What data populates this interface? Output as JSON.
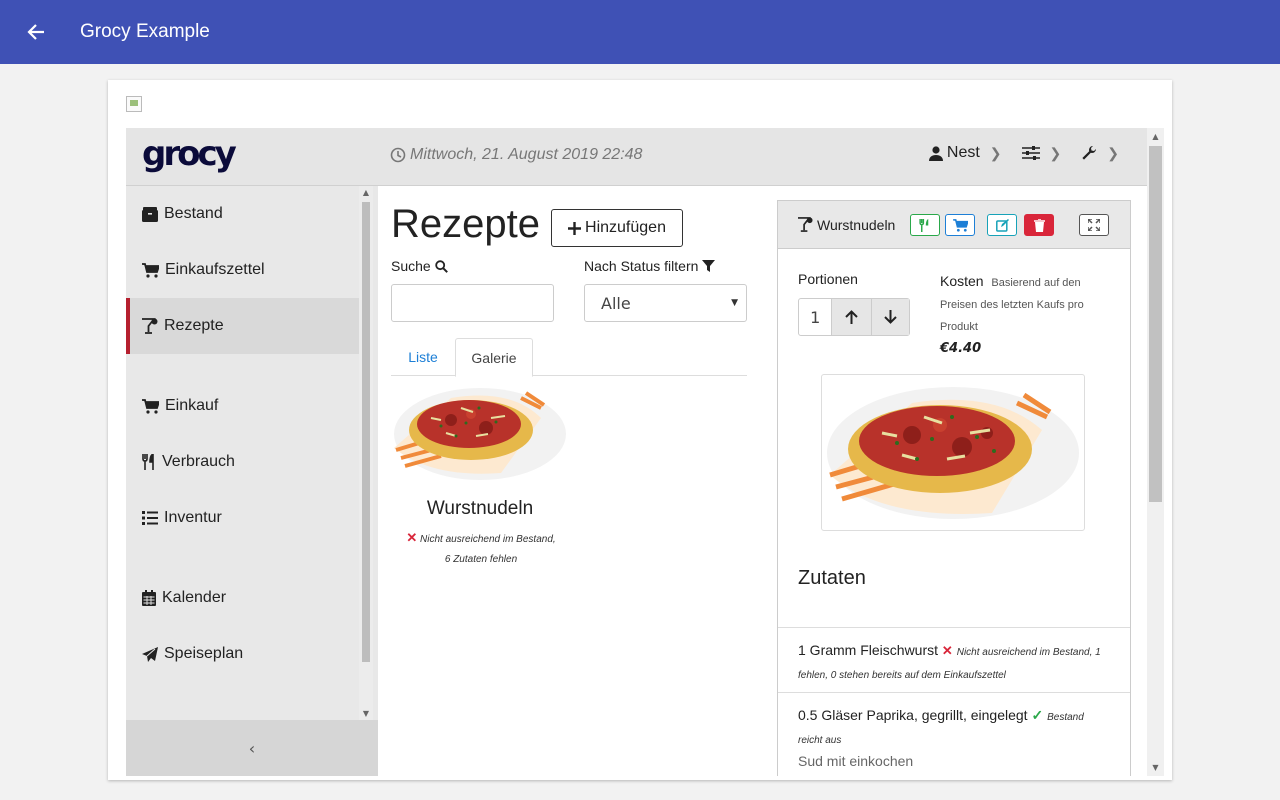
{
  "appbar": {
    "title": "Grocy Example",
    "back_icon": "arrow-back-icon"
  },
  "header": {
    "logo": "grocy",
    "datetime": "Mittwoch, 21. August 2019 22:48",
    "user": "Nest"
  },
  "sidebar": {
    "items": [
      {
        "label": "Bestand",
        "icon": "box-icon"
      },
      {
        "label": "Einkaufszettel",
        "icon": "cart-icon"
      },
      {
        "label": "Rezepte",
        "icon": "cocktail-icon",
        "active": true
      },
      {
        "label": "Einkauf",
        "icon": "cart-icon"
      },
      {
        "label": "Verbrauch",
        "icon": "utensils-icon"
      },
      {
        "label": "Inventur",
        "icon": "list-icon"
      },
      {
        "label": "Kalender",
        "icon": "calendar-icon"
      },
      {
        "label": "Speiseplan",
        "icon": "paper-plane-icon"
      }
    ],
    "collapse_label": "‹"
  },
  "main": {
    "title": "Rezepte",
    "add_label": "Hinzufügen",
    "search_label": "Suche",
    "search_value": "",
    "filter_label": "Nach Status filtern",
    "filter_value": "Alle",
    "tabs": [
      {
        "label": "Liste"
      },
      {
        "label": "Galerie"
      }
    ],
    "gallery": [
      {
        "title": "Wurstnudeln",
        "status": "Nicht ausreichend im Bestand, 6 Zutaten fehlen"
      }
    ]
  },
  "detail": {
    "title": "Wurstnudeln",
    "portionen_label": "Portionen",
    "portionen_value": "1",
    "kosten_label": "Kosten",
    "kosten_note": "Basierend auf den Preisen des letzten Kaufs pro Produkt",
    "price": "€4.40",
    "zutaten_title": "Zutaten",
    "ingredients": [
      {
        "text": "1 Gramm Fleischwurst",
        "status": "Nicht ausreichend im Bestand, 1 fehlen, 0 stehen bereits auf dem Einkaufszettel",
        "ok": false
      },
      {
        "text": "0.5 Gläser Paprika, gegrillt, eingelegt",
        "status": "Bestand reicht aus",
        "ok": true,
        "note": "Sud mit einkochen"
      }
    ]
  },
  "colors": {
    "appbar": "#3f51b5",
    "active_border": "#b51f2e",
    "link": "#1d7fd6",
    "danger": "#d9263a",
    "success": "#2aa84a"
  }
}
